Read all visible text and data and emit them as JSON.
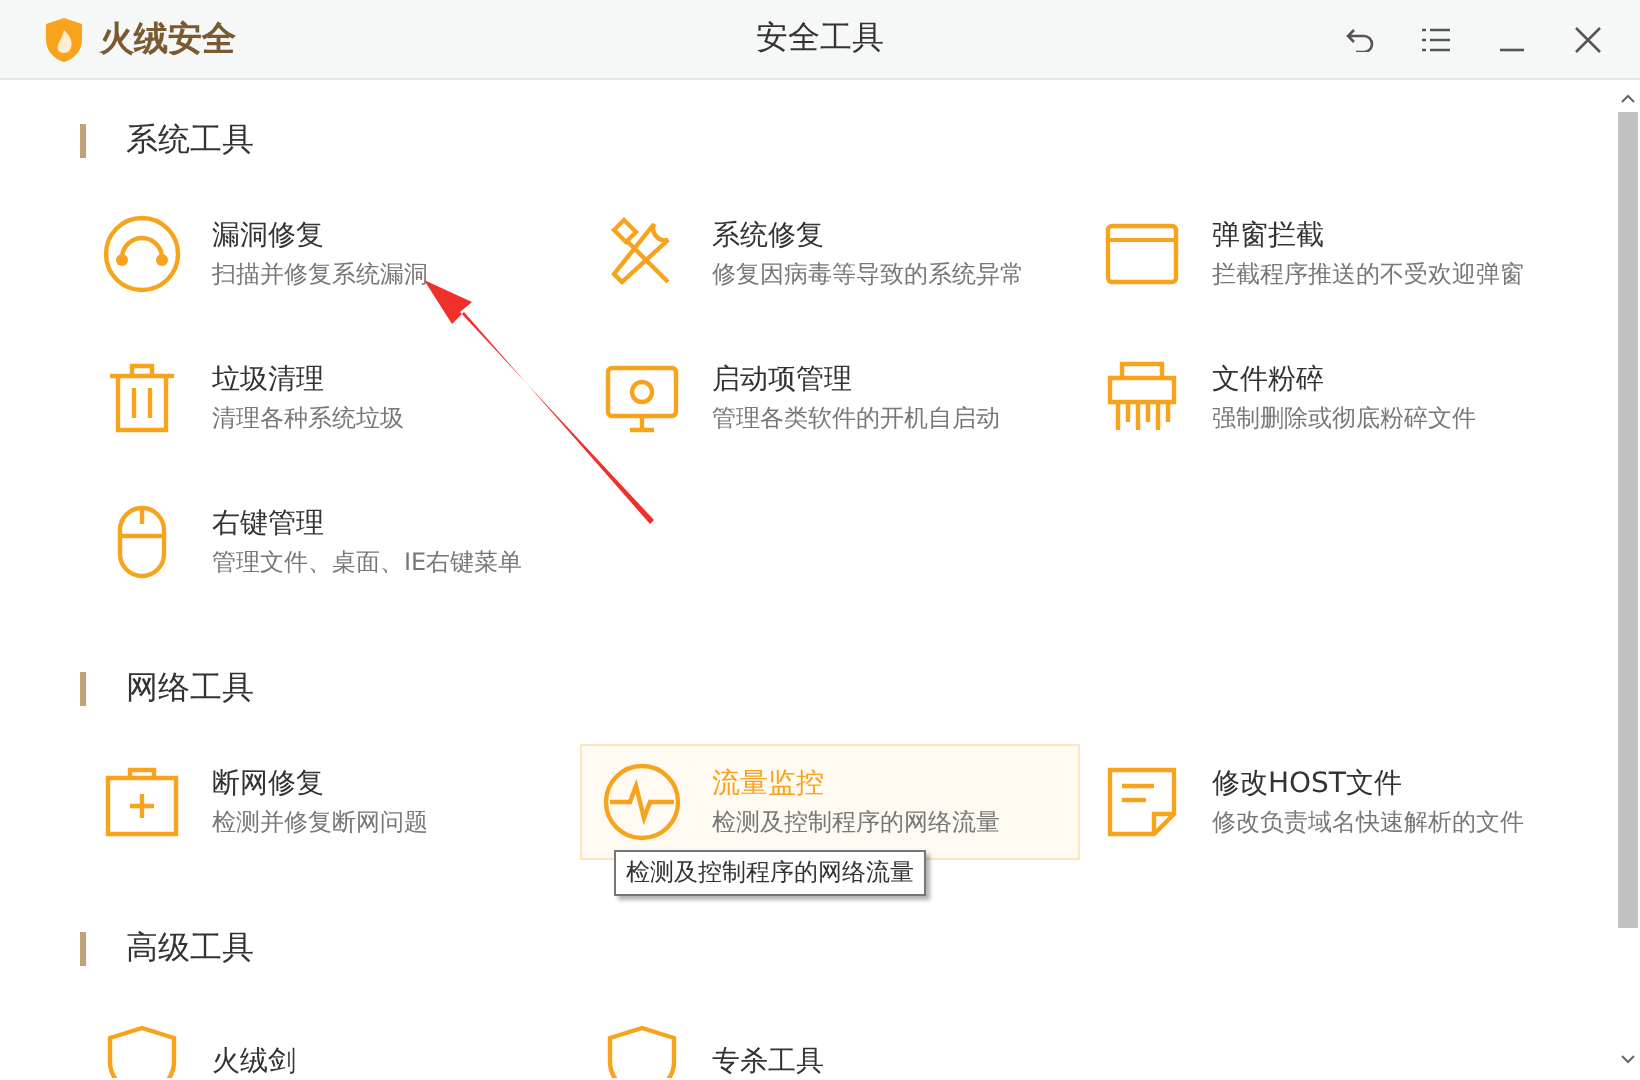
{
  "window": {
    "app_name": "火绒安全",
    "title": "安全工具"
  },
  "sections": [
    {
      "title": "系统工具",
      "items": [
        {
          "kind": "vuln",
          "title": "漏洞修复",
          "desc": "扫描并修复系统漏洞",
          "hovered": false
        },
        {
          "kind": "repair",
          "title": "系统修复",
          "desc": "修复因病毒等导致的系统异常",
          "hovered": false
        },
        {
          "kind": "popup",
          "title": "弹窗拦截",
          "desc": "拦截程序推送的不受欢迎弹窗",
          "hovered": false
        },
        {
          "kind": "trash",
          "title": "垃圾清理",
          "desc": "清理各种系统垃圾",
          "hovered": false
        },
        {
          "kind": "startup",
          "title": "启动项管理",
          "desc": "管理各类软件的开机自启动",
          "hovered": false
        },
        {
          "kind": "shredder",
          "title": "文件粉碎",
          "desc": "强制删除或彻底粉碎文件",
          "hovered": false
        },
        {
          "kind": "mouse",
          "title": "右键管理",
          "desc": "管理文件、桌面、IE右键菜单",
          "hovered": false
        }
      ]
    },
    {
      "title": "网络工具",
      "items": [
        {
          "kind": "netfix",
          "title": "断网修复",
          "desc": "检测并修复断网问题",
          "hovered": false
        },
        {
          "kind": "traffic",
          "title": "流量监控",
          "desc": "检测及控制程序的网络流量",
          "hovered": true,
          "tooltip": "检测及控制程序的网络流量"
        },
        {
          "kind": "hosts",
          "title": "修改HOST文件",
          "desc": "修改负责域名快速解析的文件",
          "hovered": false
        }
      ]
    },
    {
      "title": "高级工具",
      "items": [
        {
          "kind": "shield",
          "title": "火绒剑",
          "hovered": false
        },
        {
          "kind": "shield",
          "title": "专杀工具",
          "hovered": false
        }
      ]
    }
  ]
}
